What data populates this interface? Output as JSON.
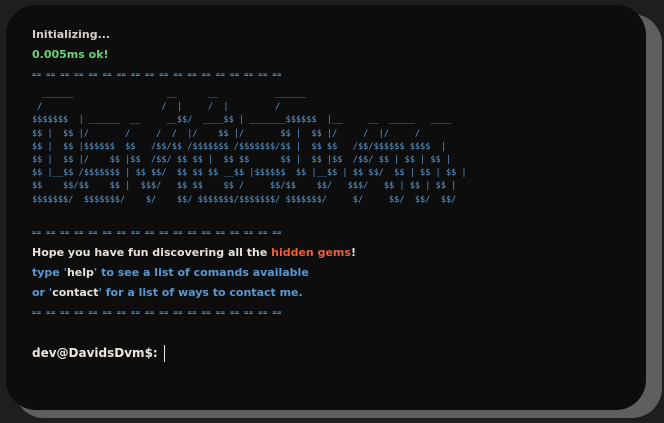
{
  "boot": {
    "status": "Initializing...",
    "timing": "0.005ms ok!",
    "separator": "== == == == == == == == == == == == == == == == == =="
  },
  "banner": {
    "ascii": "  ______                  __      __           ______\n /                       /  |     /  |         /\n$$$$$$$  | ______  __     __$$/  ____$$ | _______$$$$$$  |__     __  _____   ____\n$$ |  $$ |/       /     /  /  |/    $$ |/       $$ |  $$ |/     /  |/     /\n$$ |  $$ |$$$$$$  $$   /$$/$$ /$$$$$$$ /$$$$$$$/$$ |  $$ $$   /$$/$$$$$$ $$$$  |\n$$ |  $$ |/    $$ |$$  /$$/ $$ $$ |  $$ $$      $$ |  $$ |$$  /$$/ $$ | $$ | $$ |\n$$ |__$$ /$$$$$$$ | $$ $$/  $$ $$ $$ __$$ |$$$$$$  $$ |__$$ | $$ $$/  $$ | $$ | $$ |\n$$    $$/$$    $$ |  $$$/   $$ $$    $$ /     $$/$$    $$/   $$$/   $$ | $$ | $$ |\n$$$$$$$/  $$$$$$$/    $/    $$/ $$$$$$$/$$$$$$$/ $$$$$$$/     $/     $$/  $$/  $$/"
  },
  "welcome": {
    "line1_before": "Hope you have fun discovering all the ",
    "line1_highlight": "hidden gems",
    "line1_after": "!",
    "line2_before": "type '",
    "line2_cmd": "help",
    "line2_after": "' to see a list of comands available",
    "line3_before": "or '",
    "line3_cmd": "contact",
    "line3_after": "' for a list of ways to contact me."
  },
  "prompt": {
    "label": "dev@DavidsDvm$:",
    "value": ""
  },
  "colors": {
    "background": "#0d0d0d",
    "frame_shadow": "#5f5f5f",
    "text": "#d4d0c8",
    "ok_green": "#6ad275",
    "accent_blue": "#5a98cf",
    "highlight_red": "#e8603e"
  }
}
